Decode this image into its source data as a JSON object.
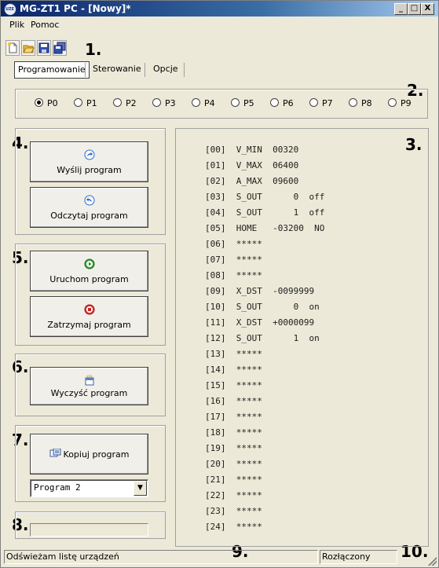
{
  "window": {
    "title": "MG-ZT1 PC  -  [Nowy]*",
    "app_icon_text": "UZE"
  },
  "caption_buttons": {
    "minimize": "_",
    "maximize": "□",
    "close": "X"
  },
  "menu": [
    "Plik",
    "Pomoc"
  ],
  "toolbar": {
    "icons": [
      "new-file-icon",
      "open-folder-icon",
      "save-icon",
      "save-all-icon"
    ]
  },
  "markers": [
    "1.",
    "2.",
    "3.",
    "4.",
    "5.",
    "6.",
    "7.",
    "8.",
    "9.",
    "10."
  ],
  "tabs": [
    {
      "label": "Programowanie",
      "active": true
    },
    {
      "label": "Sterowanie",
      "active": false
    },
    {
      "label": "Opcje",
      "active": false
    }
  ],
  "program_radios": [
    {
      "label": "P0",
      "selected": true
    },
    {
      "label": "P1",
      "selected": false
    },
    {
      "label": "P2",
      "selected": false
    },
    {
      "label": "P3",
      "selected": false
    },
    {
      "label": "P4",
      "selected": false
    },
    {
      "label": "P5",
      "selected": false
    },
    {
      "label": "P6",
      "selected": false
    },
    {
      "label": "P7",
      "selected": false
    },
    {
      "label": "P8",
      "selected": false
    },
    {
      "label": "P9",
      "selected": false
    }
  ],
  "buttons": {
    "send": "Wyślij program",
    "read": "Odczytaj program",
    "run": "Uruchom program",
    "stop": "Zatrzymaj program",
    "clear": "Wyczyść program",
    "copy": "Kopiuj program"
  },
  "copy_target": {
    "selected": "Program 2",
    "dropdown_arrow": "▼"
  },
  "progress": {
    "value": 0
  },
  "program_lines": [
    "[00]  V_MIN  00320",
    "[01]  V_MAX  06400",
    "[02]  A_MAX  09600",
    "[03]  S_OUT      0  off",
    "[04]  S_OUT      1  off",
    "[05]  HOME   -03200  NO",
    "[06]  *****",
    "[07]  *****",
    "[08]  *****",
    "[09]  X_DST  -0099999",
    "[10]  S_OUT      0  on",
    "[11]  X_DST  +0000099",
    "[12]  S_OUT      1  on",
    "[13]  *****",
    "[14]  *****",
    "[15]  *****",
    "[16]  *****",
    "[17]  *****",
    "[18]  *****",
    "[19]  *****",
    "[20]  *****",
    "[21]  *****",
    "[22]  *****",
    "[23]  *****",
    "[24]  *****"
  ],
  "status": {
    "message": "Odświeżam listę urządzeń",
    "connection": "Rozłączony"
  }
}
